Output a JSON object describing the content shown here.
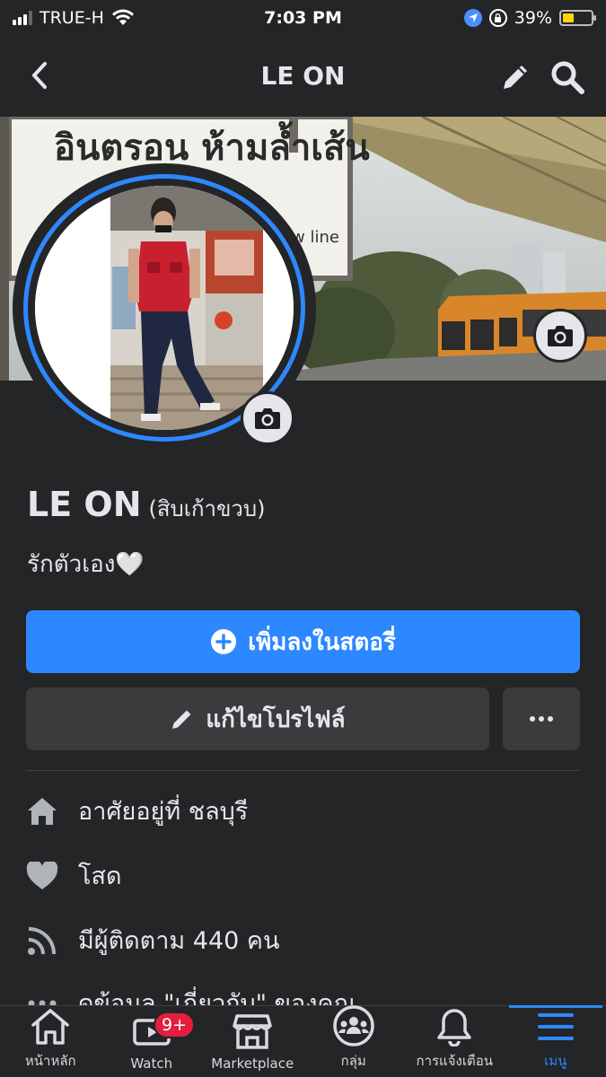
{
  "status_bar": {
    "carrier": "TRUE-H",
    "time": "7:03 PM",
    "battery_percent": "39%",
    "battery_level": 0.39,
    "icons": [
      "signal-icon",
      "wifi-icon",
      "location-icon",
      "orientation-lock-icon",
      "battery-icon"
    ]
  },
  "nav": {
    "title": "LE ON",
    "icons": [
      "back-icon",
      "pencil-icon",
      "search-icon"
    ]
  },
  "cover": {
    "sign_text_line1": "อินตรอน ห้ามล้ำเส้น",
    "sign_text_line2": "ow line"
  },
  "profile": {
    "name": "LE ON",
    "alternate_name": "(สิบเก้าขวบ)",
    "bio": "รักตัวเอง🤍"
  },
  "actions": {
    "add_story_label": "เพิ่มลงในสตอรี่",
    "edit_profile_label": "แก้ไขโปรไฟล์",
    "more_label": "···"
  },
  "details": {
    "lives_in": "อาศัยอยู่ที่ ชลบุรี",
    "relationship": "โสด",
    "followers": "มีผู้ติดตาม 440 คน",
    "see_about": "ดูข้อมูล \"เกี่ยวกับ\" ของคุณ"
  },
  "tabs": [
    {
      "label": "หน้าหลัก",
      "icon": "home-icon"
    },
    {
      "label": "Watch",
      "icon": "watch-icon",
      "badge": "9+"
    },
    {
      "label": "Marketplace",
      "icon": "marketplace-icon"
    },
    {
      "label": "กลุ่ม",
      "icon": "groups-icon"
    },
    {
      "label": "การแจ้งเตือน",
      "icon": "bell-icon"
    },
    {
      "label": "เมนู",
      "icon": "menu-icon",
      "active": true
    }
  ],
  "colors": {
    "background": "#242526",
    "accent": "#2d88ff",
    "button_secondary": "#3a3b3c",
    "badge": "#e41e3f"
  }
}
